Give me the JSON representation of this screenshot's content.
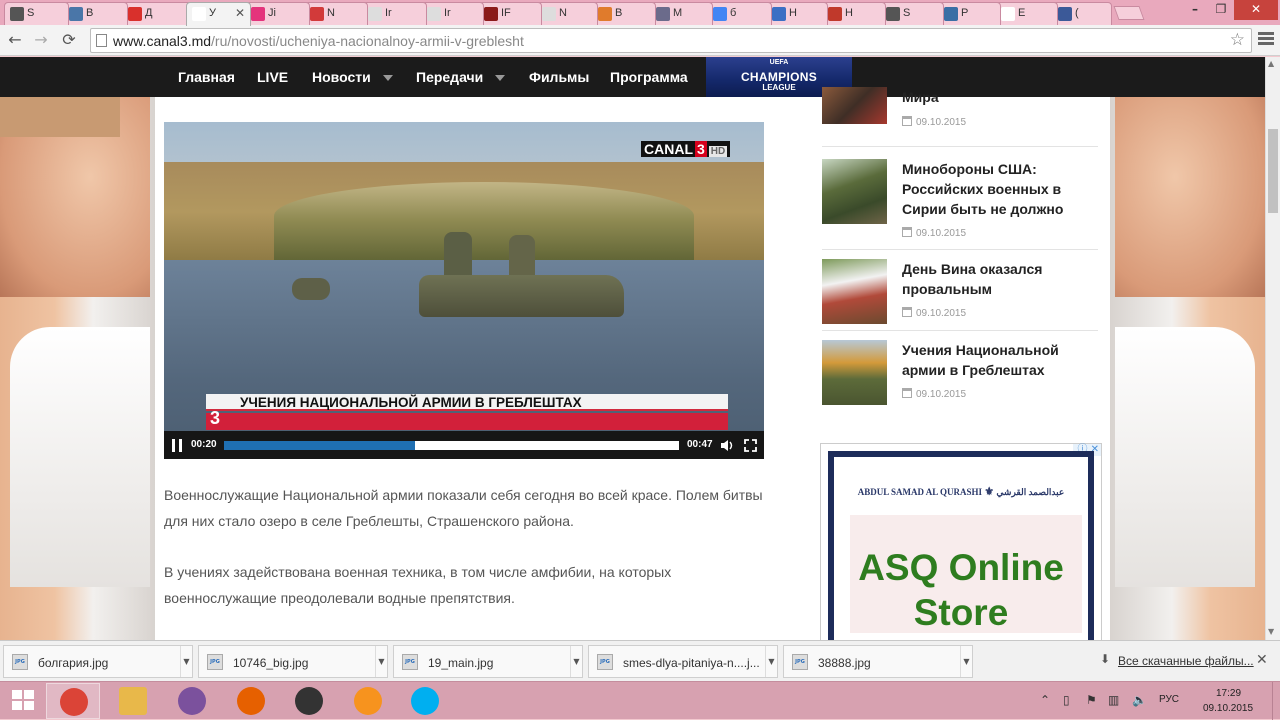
{
  "browser": {
    "tabs": [
      {
        "label": "S",
        "favicon_color": "#555555",
        "active": false
      },
      {
        "label": "В",
        "favicon_color": "#4a76a8",
        "active": false
      },
      {
        "label": "Д",
        "favicon_color": "#d9302c",
        "active": false
      },
      {
        "label": "У",
        "favicon_color": "#ffffff",
        "active": true
      },
      {
        "label": "Ji",
        "favicon_color": "#e4337c",
        "active": false
      },
      {
        "label": "N",
        "favicon_color": "#d23a3a",
        "active": false
      },
      {
        "label": "Ir",
        "favicon_color": "#dddddd",
        "active": false
      },
      {
        "label": "Ir",
        "favicon_color": "#dddddd",
        "active": false
      },
      {
        "label": "IF",
        "favicon_color": "#8b1a1a",
        "active": false
      },
      {
        "label": "N",
        "favicon_color": "#dddddd",
        "active": false
      },
      {
        "label": "B",
        "favicon_color": "#e07b2c",
        "active": false
      },
      {
        "label": "M",
        "favicon_color": "#6b6b8b",
        "active": false
      },
      {
        "label": "б",
        "favicon_color": "#4285f4",
        "active": false
      },
      {
        "label": "H",
        "favicon_color": "#3b6fc4",
        "active": false
      },
      {
        "label": "H",
        "favicon_color": "#c0392b",
        "active": false
      },
      {
        "label": "S",
        "favicon_color": "#555555",
        "active": false
      },
      {
        "label": "P",
        "favicon_color": "#3a6ea5",
        "active": false
      },
      {
        "label": "E",
        "favicon_color": "#ffffff",
        "active": false
      },
      {
        "label": "(",
        "favicon_color": "#3b5998",
        "active": false
      }
    ],
    "url_host": "www.canal3.md",
    "url_path": "/ru/novosti/ucheniya-nacionalnoy-armii-v-greblesht"
  },
  "site": {
    "nav": [
      {
        "label": "Главная",
        "dropdown": false
      },
      {
        "label": "LIVE",
        "dropdown": false
      },
      {
        "label": "Новости",
        "dropdown": true
      },
      {
        "label": "Передачи",
        "dropdown": true
      },
      {
        "label": "Фильмы",
        "dropdown": false
      },
      {
        "label": "Программа",
        "dropdown": false
      }
    ],
    "banner": {
      "uefa": "UEFA",
      "title": "CHAMPIONS",
      "subtitle": "LEAGUE"
    }
  },
  "video": {
    "channel_logo": {
      "name": "CANAL",
      "number": "3",
      "hd": "HD"
    },
    "lower_third": {
      "title": "УЧЕНИЯ НАЦИОНАЛЬНОЙ АРМИИ В ГРЕБЛЕШТАХ",
      "logo_digit": "3"
    },
    "elapsed": "00:20",
    "duration": "00:47",
    "progress": 0.42
  },
  "article": {
    "paragraphs": [
      "Военнослужащие Национальной армии показали себя сегодня во всей красе. Полем битвы для них стало озеро в селе Греблешты, Страшенского района.",
      "В учениях задействована военная техника, в том числе амфибии, на которых военнослужащие преодолевали водные препятствия."
    ]
  },
  "sidebar": {
    "items": [
      {
        "title": "Мира",
        "date": "09.10.2015"
      },
      {
        "title": "Минобороны США: Российских военных в Сирии быть не должно",
        "date": "09.10.2015"
      },
      {
        "title": "День Вина оказался провальным",
        "date": "09.10.2015"
      },
      {
        "title": "Учения Национальной армии в Греблештах",
        "date": "09.10.2015"
      }
    ]
  },
  "ad": {
    "brand_latin": "ABDUL SAMAD AL QURASHI",
    "brand_arabic": "عبدالصمد القرشي",
    "headline": "ASQ Online Store",
    "brand_color": "#2e7d1f"
  },
  "downloads": {
    "items": [
      {
        "name": "болгария.jpg"
      },
      {
        "name": "10746_big.jpg"
      },
      {
        "name": "19_main.jpg"
      },
      {
        "name": "smes-dlya-pitaniya-n....j..."
      },
      {
        "name": "38888.jpg"
      }
    ],
    "show_all": "Все скачанные файлы..."
  },
  "taskbar": {
    "apps": [
      {
        "name": "chrome",
        "color": "#db4437",
        "active": true
      },
      {
        "name": "explorer",
        "color": "#e8b84a",
        "active": false
      },
      {
        "name": "viber",
        "color": "#7b519d",
        "active": false
      },
      {
        "name": "firefox",
        "color": "#e66000",
        "active": false
      },
      {
        "name": "camera",
        "color": "#333333",
        "active": false
      },
      {
        "name": "app",
        "color": "#f7931e",
        "active": false
      },
      {
        "name": "skype",
        "color": "#00aff0",
        "active": false
      }
    ],
    "language": "РУС",
    "time": "17:29",
    "date": "09.10.2015"
  }
}
